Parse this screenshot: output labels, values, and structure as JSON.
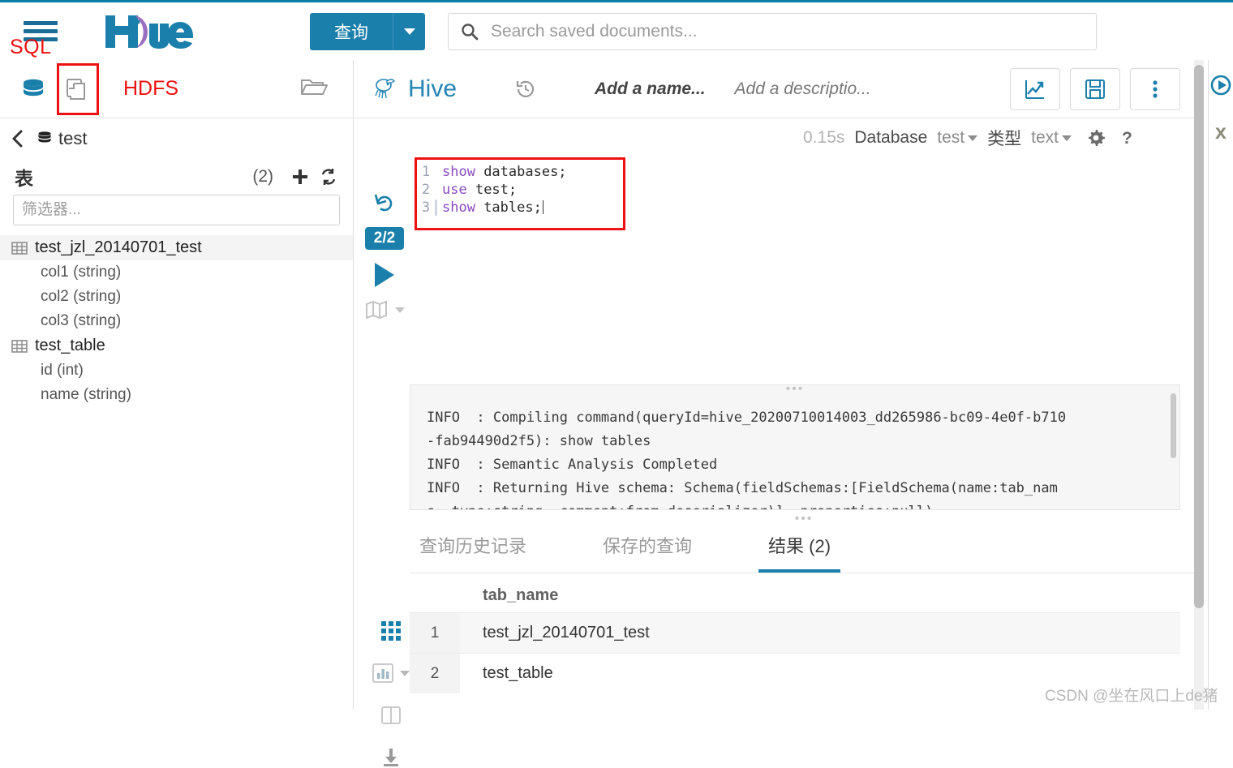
{
  "top_bar": {
    "hamburger_icon": "hamburger-menu-icon",
    "sql_annotation": "SQL",
    "logo_text": "Hue",
    "query_button_label": "查询",
    "query_dropdown_icon": "chevron-down-icon",
    "search": {
      "icon": "search-icon",
      "placeholder": "Search saved documents...",
      "value": ""
    },
    "accent_color": "#1b7fab",
    "annotation_color": "#ee1111"
  },
  "left_panel": {
    "icons": {
      "database": "database-icon",
      "documents": "documents-icon",
      "folder": "folder-open-icon"
    },
    "hdfs_annotation": "HDFS",
    "breadcrumb": {
      "back_icon": "chevron-left-icon",
      "db_icon": "database-icon",
      "database_name": "test"
    },
    "tables_header": {
      "label": "表",
      "count": "(2)",
      "add_icon": "plus-icon",
      "refresh_icon": "refresh-icon"
    },
    "filter": {
      "placeholder": "筛选器...",
      "value": ""
    },
    "tables": [
      {
        "name": "test_jzl_20140701_test",
        "selected": true,
        "columns": [
          "col1 (string)",
          "col2 (string)",
          "col3 (string)"
        ]
      },
      {
        "name": "test_table",
        "selected": false,
        "columns": [
          "id (int)",
          "name (string)"
        ]
      }
    ]
  },
  "editor": {
    "header": {
      "engine_icon": "hive-bee-icon",
      "engine_name": "Hive",
      "history_icon": "history-icon",
      "name_placeholder": "Add a name...",
      "description_placeholder": "Add a descriptio...",
      "buttons": [
        {
          "icon": "chart-trending-icon",
          "name": "visualize-button"
        },
        {
          "icon": "save-floppy-icon",
          "name": "save-button"
        },
        {
          "icon": "vertical-ellipsis-icon",
          "name": "more-options-button"
        }
      ]
    },
    "toolbar": {
      "execution_time": "0.15s",
      "database_label": "Database",
      "database_value": "test",
      "type_label": "类型",
      "type_value": "text",
      "settings_icon": "gear-icon",
      "help_icon": "question-mark-icon"
    },
    "gutter": {
      "rerun_icon": "rerun-icon",
      "progress_badge": "2/2",
      "execute_icon": "play-icon",
      "explain_icon": "map-icon",
      "explain_caret_icon": "caret-down-icon"
    },
    "code_lines": [
      {
        "number": "1",
        "keyword": "show",
        "rest": " databases;"
      },
      {
        "number": "2",
        "keyword": "use",
        "rest": " test;"
      },
      {
        "number": "3",
        "keyword": "show",
        "rest": " tables;",
        "cursor": true
      }
    ]
  },
  "log_panel": {
    "grip": "•••",
    "lines": [
      "INFO  : Compiling command(queryId=hive_20200710014003_dd265986-bc09-4e0f-b710",
      "-fab94490d2f5): show tables",
      "INFO  : Semantic Analysis Completed",
      "INFO  : Returning Hive schema: Schema(fieldSchemas:[FieldSchema(name:tab_nam",
      "e, type:string, comment:from deserializer)], properties:null)"
    ]
  },
  "tabs": [
    {
      "label": "查询历史记录",
      "active": false
    },
    {
      "label": "保存的查询",
      "active": false
    },
    {
      "label": "结果 (2)",
      "active": true
    }
  ],
  "results": {
    "view_icons": [
      {
        "name": "grid-view-icon",
        "active": true
      },
      {
        "name": "chart-view-icon",
        "active": false
      },
      {
        "name": "columns-view-icon",
        "active": false
      },
      {
        "name": "download-icon",
        "active": false
      }
    ],
    "columns": [
      "tab_name"
    ],
    "rows": [
      {
        "index": "1",
        "tab_name": "test_jzl_20140701_test"
      },
      {
        "index": "2",
        "tab_name": "test_table"
      }
    ]
  },
  "right_rail": {
    "top_icon": "circle-play-icon",
    "x_label": "x"
  },
  "watermark": "CSDN @坐在风口上de猪"
}
